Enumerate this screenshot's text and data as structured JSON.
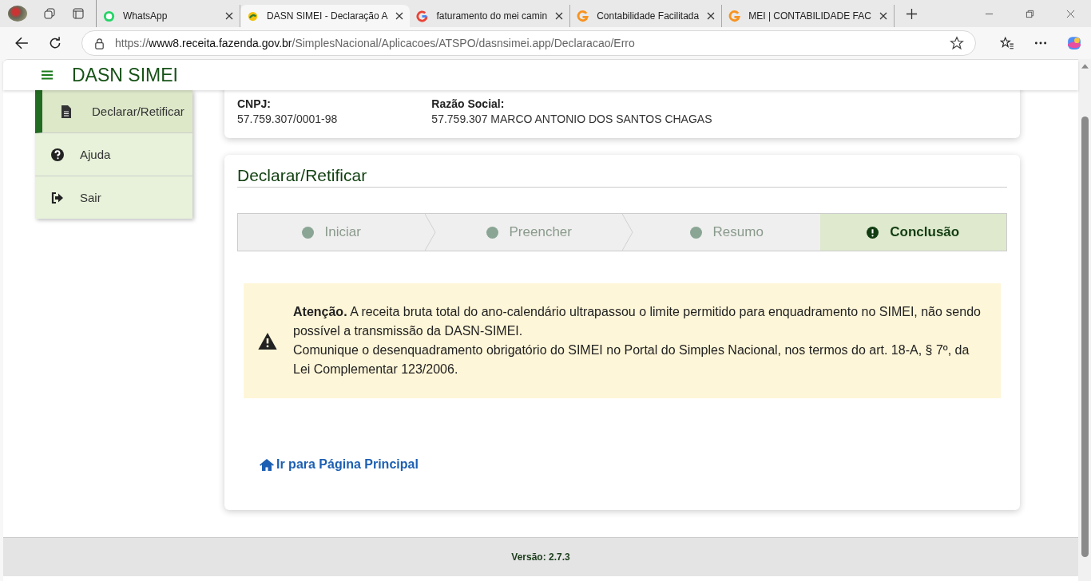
{
  "browser": {
    "tabs": [
      {
        "title": "WhatsApp",
        "selected": false
      },
      {
        "title": "DASN SIMEI - Declaração A",
        "selected": true
      },
      {
        "title": "faturamento do mei camin",
        "selected": false
      },
      {
        "title": "Contabilidade Facilitada",
        "selected": false
      },
      {
        "title": "MEI | CONTABILIDADE FAC",
        "selected": false
      }
    ],
    "address": {
      "scheme": "https://",
      "host": "www8.receita.fazenda.gov.br",
      "path": "/SimplesNacional/Aplicacoes/ATSPO/dasnsimei.app/Declaracao/Erro"
    }
  },
  "header": {
    "title": "DASN SIMEI"
  },
  "sidebar": {
    "items": [
      {
        "label": "Declarar/Retificar",
        "selected": true
      },
      {
        "label": "Ajuda",
        "selected": false
      },
      {
        "label": "Sair",
        "selected": false
      }
    ]
  },
  "company": {
    "fields": [
      {
        "label": "CNPJ:",
        "value": "57.759.307/0001-98"
      },
      {
        "label": "Razão Social:",
        "value": "57.759.307 MARCO ANTONIO DOS SANTOS CHAGAS"
      }
    ]
  },
  "panel": {
    "title": "Declarar/Retificar",
    "steps": [
      {
        "label": "Iniciar",
        "selected": false
      },
      {
        "label": "Preencher",
        "selected": false
      },
      {
        "label": "Resumo",
        "selected": false
      },
      {
        "label": "Conclusão",
        "selected": true
      }
    ],
    "alert": {
      "lines": [
        "**Atenção.** A receita bruta total do ano-calendário ultrapassou o limite permitido para enquadramento no SIMEI, não sendo possível a transmissão da DASN-SIMEI.",
        "Comunique o desenquadramento obrigatório do SIMEI no Portal do Simples Nacional, nos termos do art. 18-A, § 7º, da Lei Complementar 123/2006."
      ]
    },
    "link": "Ir para Página Principal"
  },
  "footer": {
    "version": "Versão: 2.7.3"
  }
}
